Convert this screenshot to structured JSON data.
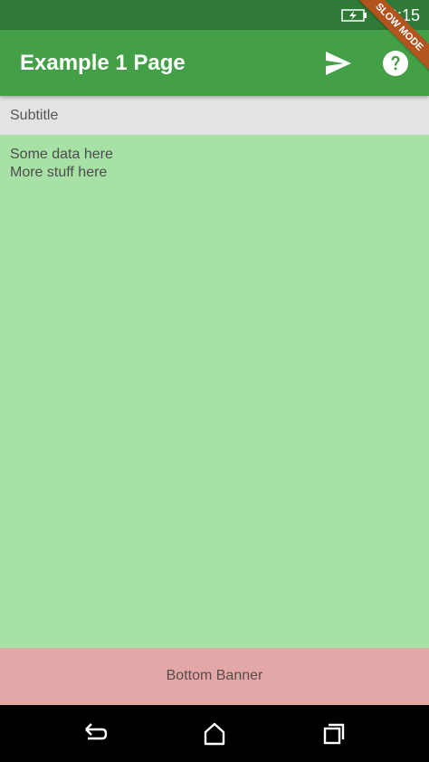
{
  "status_bar": {
    "time": "10:15"
  },
  "debug_banner": {
    "label": "SLOW MODE",
    "color": "#b3541e"
  },
  "app_bar": {
    "title": "Example 1 Page",
    "color": "#43a047",
    "actions": [
      {
        "icon": "send-icon"
      },
      {
        "icon": "help-icon"
      }
    ]
  },
  "subtitle_bar": {
    "text": "Subtitle",
    "color": "#e3e3e3"
  },
  "content": {
    "lines": [
      "Some data here",
      "More stuff here"
    ],
    "color": "#a7e1a6"
  },
  "bottom_banner": {
    "text": "Bottom Banner",
    "color": "#e2a7a6"
  },
  "nav_bar": {
    "buttons": [
      {
        "icon": "back-icon"
      },
      {
        "icon": "home-icon"
      },
      {
        "icon": "recents-icon"
      }
    ]
  }
}
